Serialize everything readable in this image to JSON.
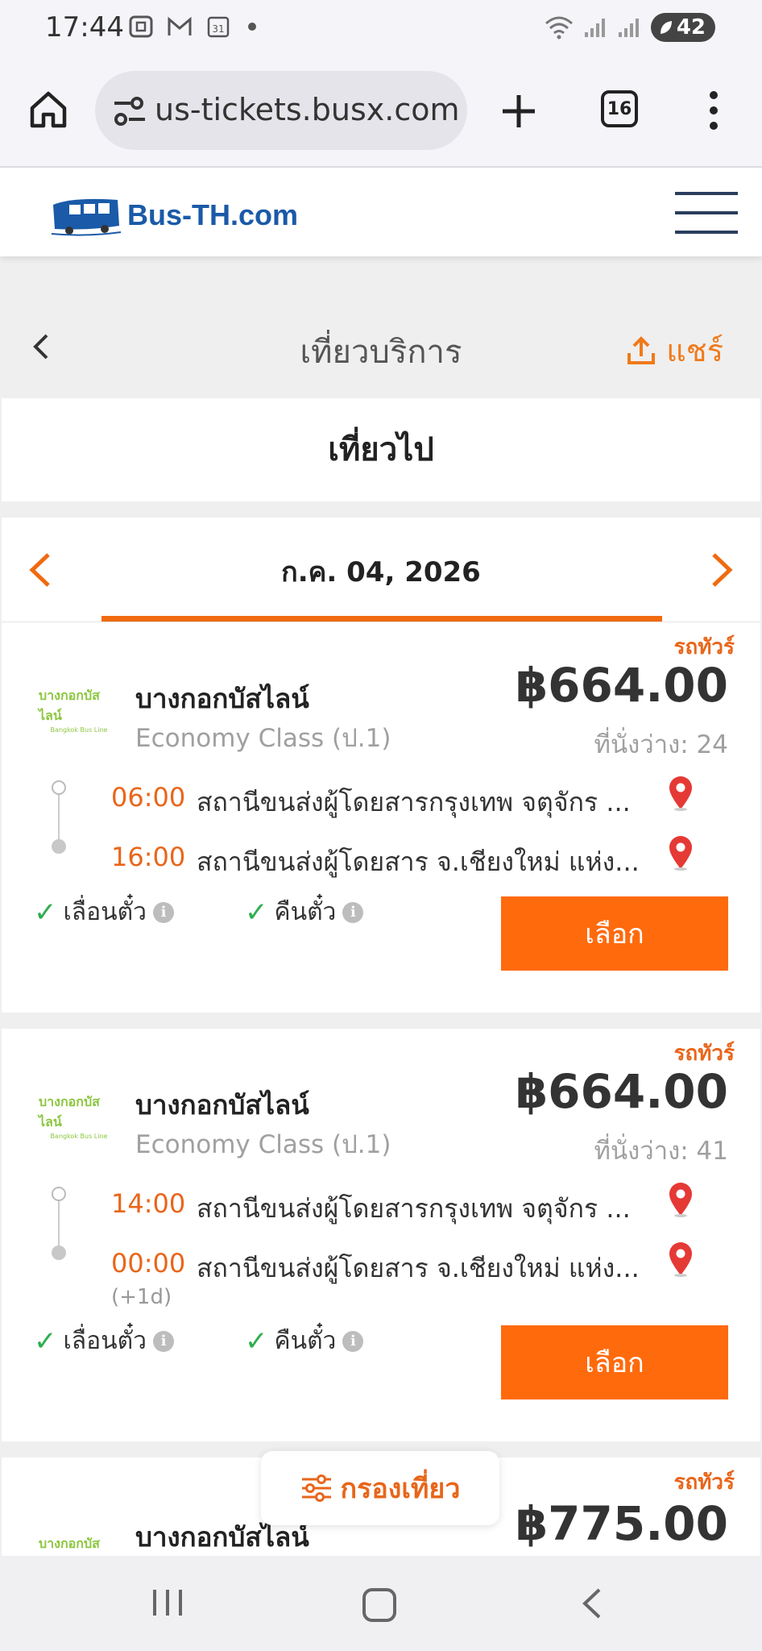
{
  "status_bar": {
    "time": "17:44",
    "battery": "42",
    "icons": [
      "screenshot-icon",
      "gmail-icon",
      "calendar-icon",
      "wifi-icon",
      "signal-icon",
      "battery-icon"
    ],
    "calendar_day": "31"
  },
  "browser": {
    "url": "us-tickets.busx.com",
    "tab_count": "16"
  },
  "site": {
    "logo_text": "Bus-TH.com"
  },
  "page": {
    "title": "เที่ยวบริการ",
    "share_label": "แชร์",
    "section_title": "เที่ยวไป",
    "date": "ก.ค. 04, 2026"
  },
  "trips": [
    {
      "tag": "รถทัวร์",
      "operator": "บางกอกบัสไลน์",
      "logo_text": "บางกอกบัสไลน์",
      "logo_subtext": "Bangkok Bus Line",
      "class": "Economy Class (ป.1)",
      "price": "฿664.00",
      "seats": "ที่นั่งว่าง: 24",
      "depart_time": "06:00",
      "depart_stop": "สถานีขนส่งผู้โดยสารกรุงเทพ จตุจักร ...",
      "arrive_time": "16:00",
      "arrive_stop": "สถานีขนส่งผู้โดยสาร จ.เชียงใหม่ แห่ง...",
      "next_day": "",
      "feature_1": "เลื่อนตั๋ว",
      "feature_2": "คืนตั๋ว",
      "select_label": "เลือก"
    },
    {
      "tag": "รถทัวร์",
      "operator": "บางกอกบัสไลน์",
      "logo_text": "บางกอกบัสไลน์",
      "logo_subtext": "Bangkok Bus Line",
      "class": "Economy Class (ป.1)",
      "price": "฿664.00",
      "seats": "ที่นั่งว่าง: 41",
      "depart_time": "14:00",
      "depart_stop": "สถานีขนส่งผู้โดยสารกรุงเทพ จตุจักร ...",
      "arrive_time": "00:00",
      "arrive_stop": "สถานีขนส่งผู้โดยสาร จ.เชียงใหม่ แห่ง...",
      "next_day": "(+1d)",
      "feature_1": "เลื่อนตั๋ว",
      "feature_2": "คืนตั๋ว",
      "select_label": "เลือก"
    },
    {
      "tag": "รถทัวร์",
      "operator": "บางกอกบัสไลน์",
      "logo_text": "บางกอกบัสไลน์",
      "price": "฿775.00"
    }
  ],
  "filter_label": "กรองเที่ยว",
  "colors": {
    "accent": "#ff6a0d",
    "accent_text": "#e8661a",
    "check": "#2eae4f",
    "pin": "#e53935",
    "brand": "#1a5aa8"
  }
}
